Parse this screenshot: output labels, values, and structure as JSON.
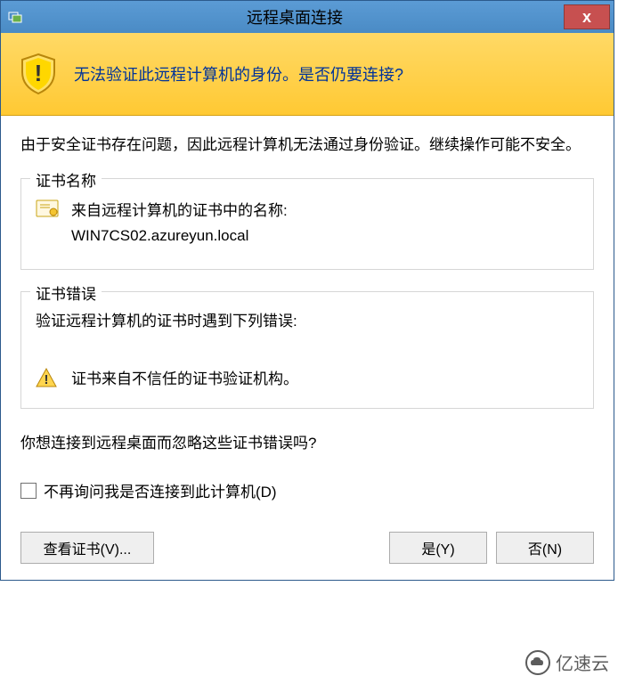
{
  "titlebar": {
    "title": "远程桌面连接",
    "close_label": "x"
  },
  "banner": {
    "message": "无法验证此远程计算机的身份。是否仍要连接?"
  },
  "intro": "由于安全证书存在问题，因此远程计算机无法通过身份验证。继续操作可能不安全。",
  "cert_name": {
    "legend": "证书名称",
    "label": "来自远程计算机的证书中的名称:",
    "value": "WIN7CS02.azureyun.local"
  },
  "cert_error": {
    "legend": "证书错误",
    "intro": "验证远程计算机的证书时遇到下列错误:",
    "message": "证书来自不信任的证书验证机构。"
  },
  "question": "你想连接到远程桌面而忽略这些证书错误吗?",
  "checkbox": {
    "label": "不再询问我是否连接到此计算机(D)"
  },
  "buttons": {
    "view_cert": "查看证书(V)...",
    "yes": "是(Y)",
    "no": "否(N)"
  },
  "watermark": "亿速云"
}
